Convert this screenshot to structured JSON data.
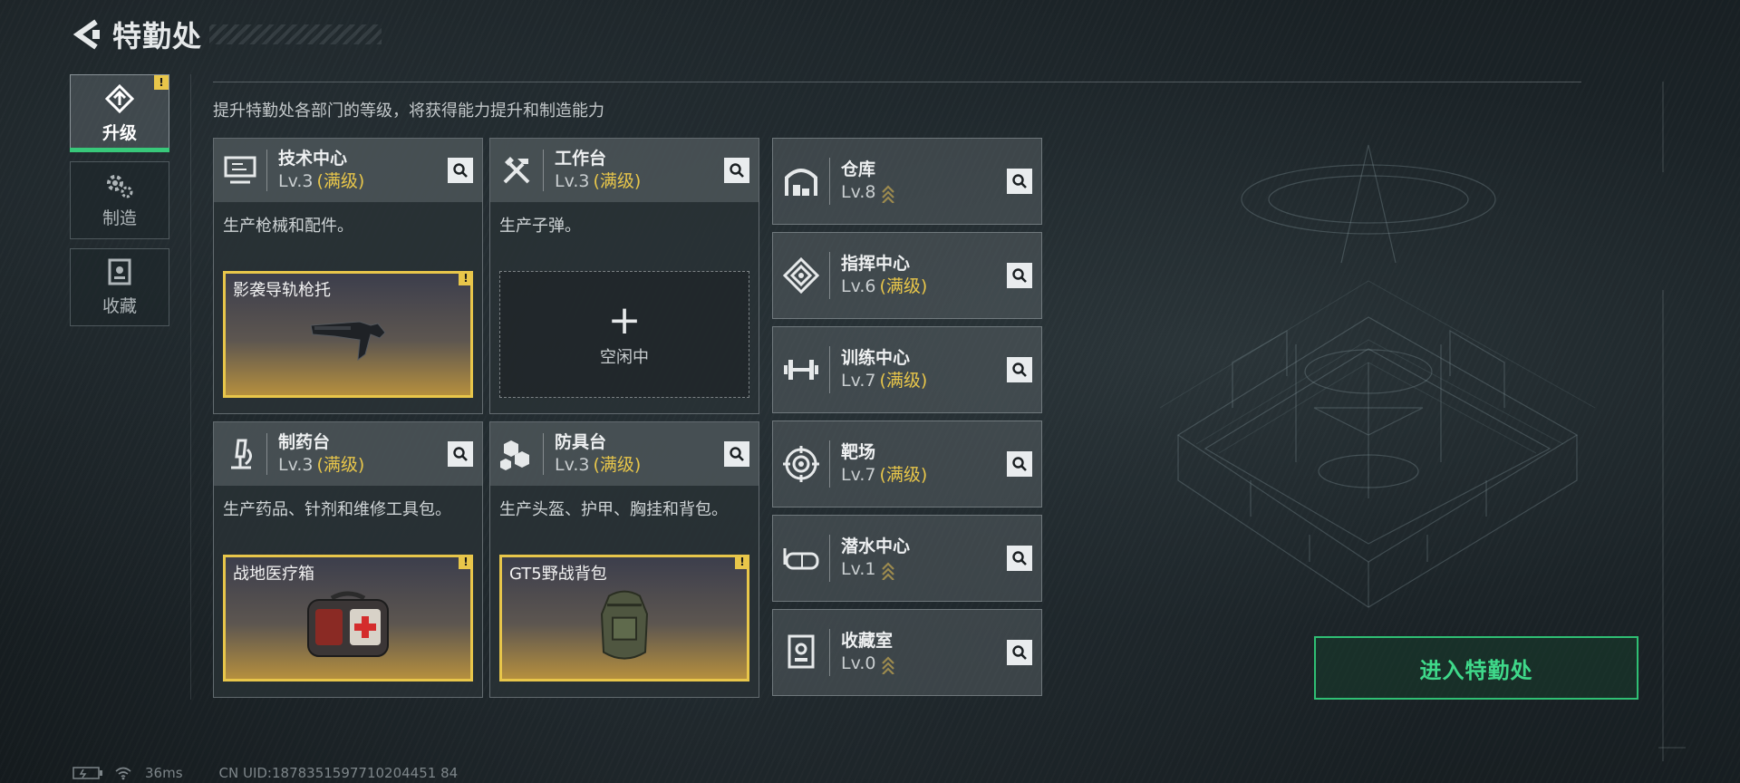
{
  "header": {
    "title": "特勤处"
  },
  "nav": {
    "items": [
      {
        "label": "升级",
        "icon": "upgrade-icon",
        "active": true,
        "alert": "!"
      },
      {
        "label": "制造",
        "icon": "gears-icon",
        "active": false
      },
      {
        "label": "收藏",
        "icon": "collection-icon",
        "active": false
      }
    ]
  },
  "subtitle": "提升特勤处各部门的等级，将获得能力提升和制造能力",
  "cards": [
    {
      "name": "技术中心",
      "level": "Lv.3",
      "max": "(满级)",
      "icon": "computer-icon",
      "desc": "生产枪械和配件。",
      "slot": {
        "label": "影袭导轨枪托",
        "alert": "!",
        "item_icon": "rifle-stock-icon"
      }
    },
    {
      "name": "工作台",
      "level": "Lv.3",
      "max": "(满级)",
      "icon": "tools-icon",
      "desc": "生产子弹。",
      "slot_empty": {
        "plus": "+",
        "label": "空闲中"
      }
    },
    {
      "name": "制药台",
      "level": "Lv.3",
      "max": "(满级)",
      "icon": "microscope-icon",
      "desc": "生产药品、针剂和维修工具包。",
      "slot": {
        "label": "战地医疗箱",
        "alert": "!",
        "item_icon": "medkit-icon"
      }
    },
    {
      "name": "防具台",
      "level": "Lv.3",
      "max": "(满级)",
      "icon": "armor-icon",
      "desc": "生产头盔、护甲、胸挂和背包。",
      "slot": {
        "label": "GT5野战背包",
        "alert": "!",
        "item_icon": "backpack-icon"
      }
    }
  ],
  "rooms": [
    {
      "name": "仓库",
      "level": "Lv.8",
      "max": "",
      "icon": "warehouse-icon",
      "upgrade_hint": true
    },
    {
      "name": "指挥中心",
      "level": "Lv.6",
      "max": "(满级)",
      "icon": "command-icon",
      "upgrade_hint": false
    },
    {
      "name": "训练中心",
      "level": "Lv.7",
      "max": "(满级)",
      "icon": "dumbbell-icon",
      "upgrade_hint": false
    },
    {
      "name": "靶场",
      "level": "Lv.7",
      "max": "(满级)",
      "icon": "target-icon",
      "upgrade_hint": false
    },
    {
      "name": "潜水中心",
      "level": "Lv.1",
      "max": "",
      "icon": "diving-mask-icon",
      "upgrade_hint": true
    },
    {
      "name": "收藏室",
      "level": "Lv.0",
      "max": "",
      "icon": "display-case-icon",
      "upgrade_hint": true
    }
  ],
  "enter_button": "进入特勤处",
  "footer": {
    "ping": "36ms",
    "uid": "CN UID:1878351597710204451 84"
  },
  "colors": {
    "accent_green": "#38c87a",
    "max_gold": "#e8c64a",
    "enter_text": "#3fd98a"
  }
}
